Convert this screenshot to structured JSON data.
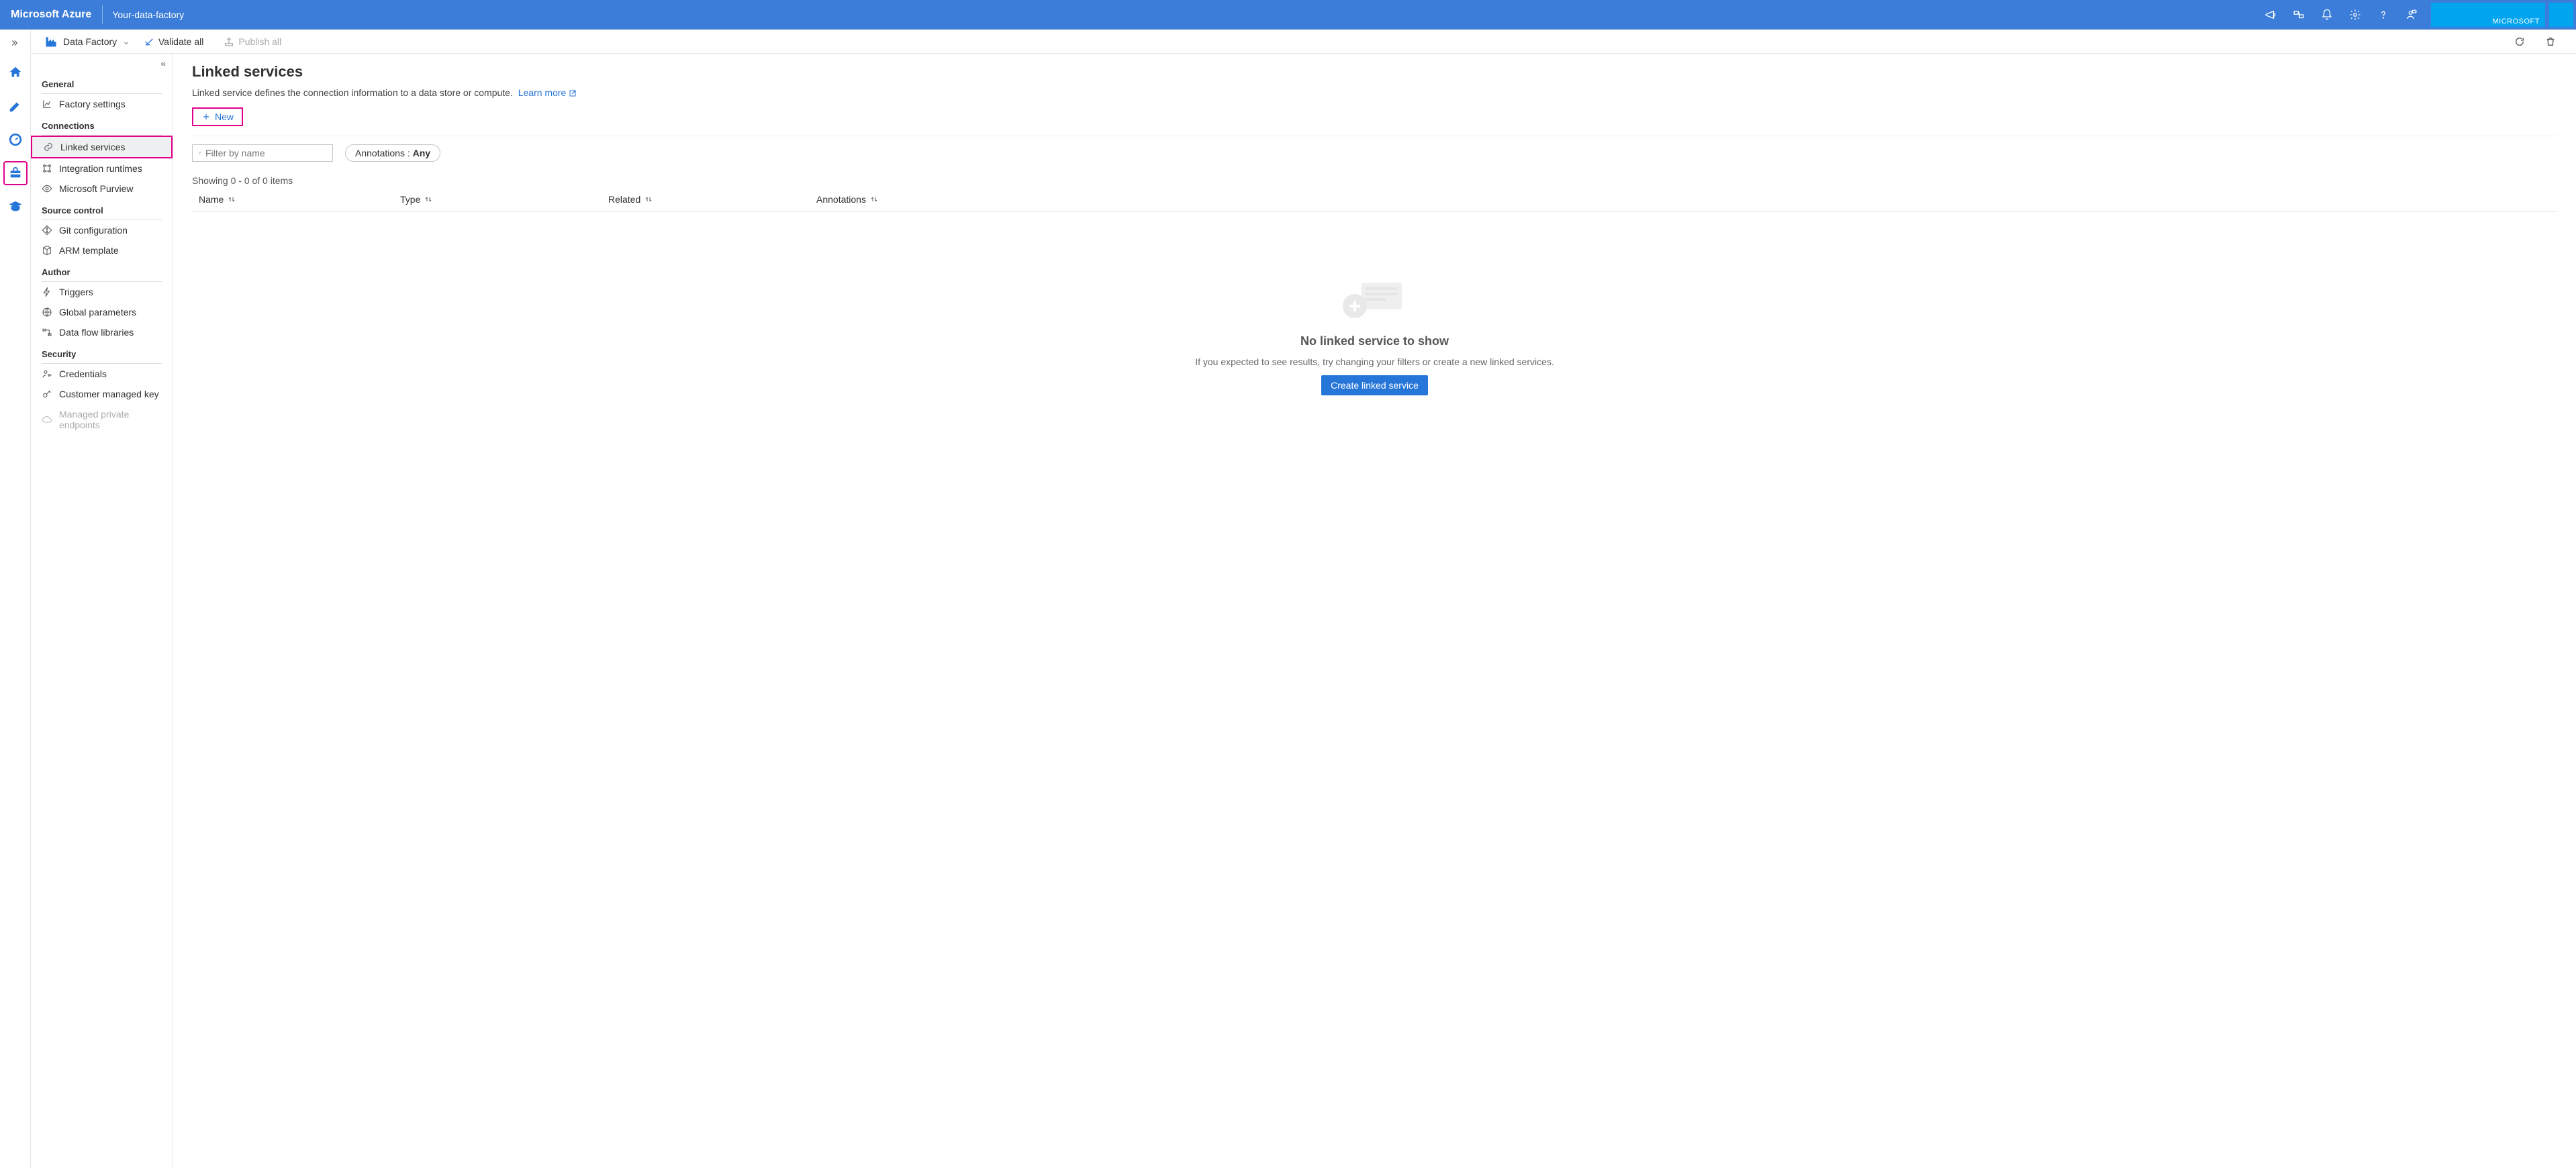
{
  "header": {
    "brand": "Microsoft Azure",
    "factory_name": "Your-data-factory",
    "tenant": "MICROSOFT"
  },
  "command_bar": {
    "scope": "Data Factory",
    "validate": "Validate all",
    "publish": "Publish all"
  },
  "side_panel": {
    "sections": {
      "general": "General",
      "connections": "Connections",
      "source_control": "Source control",
      "author": "Author",
      "security": "Security"
    },
    "items": {
      "factory_settings": "Factory settings",
      "linked_services": "Linked services",
      "integration_runtimes": "Integration runtimes",
      "purview": "Microsoft Purview",
      "git_config": "Git configuration",
      "arm_template": "ARM template",
      "triggers": "Triggers",
      "global_params": "Global parameters",
      "dataflow_libs": "Data flow libraries",
      "credentials": "Credentials",
      "cmk": "Customer managed key",
      "managed_pe": "Managed private endpoints"
    }
  },
  "main": {
    "title": "Linked services",
    "description": "Linked service defines the connection information to a data store or compute.",
    "learn_more": "Learn more",
    "new_label": "New",
    "filter_placeholder": "Filter by name",
    "annotations_label": "Annotations : ",
    "annotations_value": "Any",
    "showing": "Showing 0 - 0 of 0 items",
    "columns": {
      "name": "Name",
      "type": "Type",
      "related": "Related",
      "annotations": "Annotations"
    },
    "empty": {
      "title": "No linked service to show",
      "subtitle": "If you expected to see results, try changing your filters or create a new linked services.",
      "cta": "Create linked service"
    }
  }
}
